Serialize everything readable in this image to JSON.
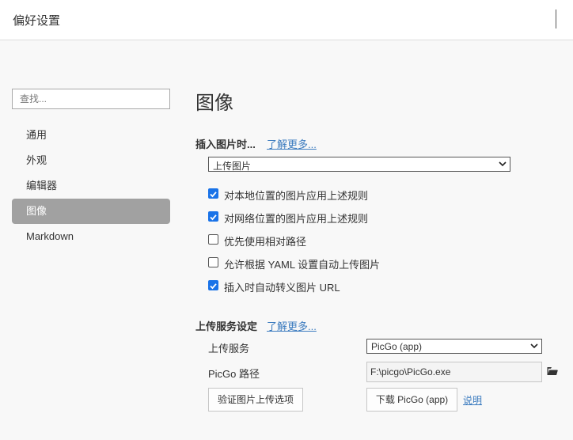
{
  "window": {
    "title": "偏好设置"
  },
  "sidebar": {
    "search_placeholder": "查找...",
    "items": [
      {
        "label": "通用",
        "active": false
      },
      {
        "label": "外观",
        "active": false
      },
      {
        "label": "编辑器",
        "active": false
      },
      {
        "label": "图像",
        "active": true
      },
      {
        "label": "Markdown",
        "active": false
      }
    ]
  },
  "main": {
    "heading": "图像",
    "insert_section": {
      "title": "插入图片时...",
      "learn_more": "了解更多...",
      "select_value": "上传图片",
      "options": [
        {
          "label": "对本地位置的图片应用上述规则",
          "checked": true
        },
        {
          "label": "对网络位置的图片应用上述规则",
          "checked": true
        },
        {
          "label": "优先使用相对路径",
          "checked": false
        },
        {
          "label": "允许根据 YAML 设置自动上传图片",
          "checked": false
        },
        {
          "label": "插入时自动转义图片 URL",
          "checked": true
        }
      ]
    },
    "upload_section": {
      "title": "上传服务设定",
      "learn_more": "了解更多...",
      "service_label": "上传服务",
      "service_value": "PicGo (app)",
      "path_label": "PicGo 路径",
      "path_value": "F:\\picgo\\PicGo.exe",
      "verify_button": "验证图片上传选项",
      "download_button": "下载 PicGo (app)",
      "explain_link": "说明"
    }
  },
  "colors": {
    "accent": "#1a73e8",
    "link": "#3b7bbf",
    "active_nav": "#a1a1a1"
  },
  "icons": {
    "folder": "folder-icon",
    "chevron": "chevron-down-icon"
  }
}
